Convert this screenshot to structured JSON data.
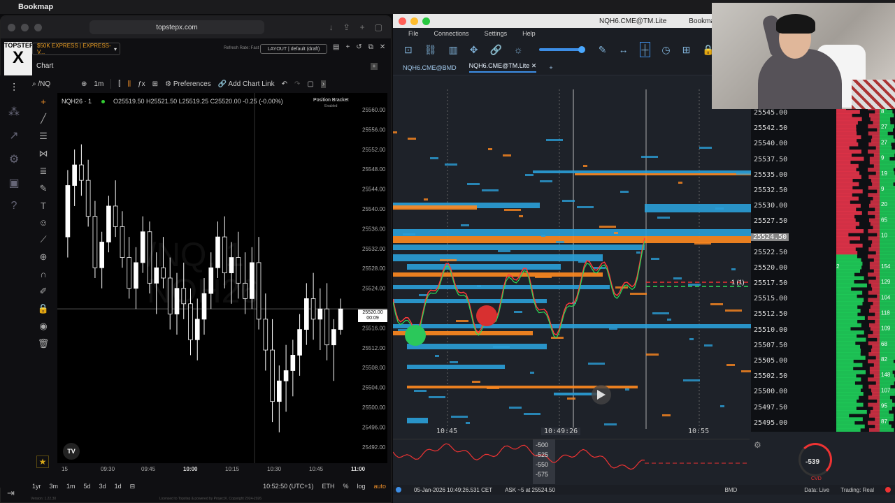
{
  "menubar": {
    "app": "Bookmap"
  },
  "browser": {
    "url": "topstepx.com",
    "logo_top": "TOPSTEP",
    "logo_big": "X",
    "account": "$50K EXPRESS | EXPRESS-V...",
    "refresh_rate": "Refresh Rate: Fast",
    "layout": "LAYOUT | default (draft)",
    "chart_tab": "Chart",
    "version": "Version: 1.22.30",
    "footer": "Licensed to Topstep & powered by ProjectX. Copyright 2024-2026"
  },
  "tv": {
    "symbol_search": "/NQ",
    "interval": "1m",
    "preferences": "Preferences",
    "add_chart_link": "Add Chart Link",
    "legend_symbol": "NQH26 · 1",
    "ohlc": "O25519.50  H25521.50  L25519.25  C25520.00  -0.25 (-0.00%)",
    "position_bracket": "Position Bracket",
    "position_bracket_sub": "Enabled",
    "watermark_line1": "/NQ, 1",
    "watermark_line2": "NQH26",
    "price_badge": "25520.00",
    "price_badge_timer": "00:09",
    "tv_logo": "TV",
    "price_ticks": [
      "25560.00",
      "25556.00",
      "25552.00",
      "25548.00",
      "25544.00",
      "25540.00",
      "25536.00",
      "25532.00",
      "25528.00",
      "25524.00",
      "",
      "25516.00",
      "25512.00",
      "25508.00",
      "25504.00",
      "25500.00",
      "25496.00",
      "25492.00"
    ],
    "time_ticks": [
      "15",
      "09:30",
      "09:45",
      "10:00",
      "10:15",
      "10:30",
      "10:45",
      "11:00"
    ],
    "ranges": [
      "1yr",
      "3m",
      "1m",
      "5d",
      "3d",
      "1d"
    ],
    "clock": "10:52:50 (UTC+1)",
    "session": "ETH",
    "pct": "%",
    "log": "log",
    "auto": "auto",
    "candles": [
      [
        25534,
        25547,
        25530,
        25544
      ],
      [
        25544,
        25551,
        25540,
        25548
      ],
      [
        25548,
        25552,
        25542,
        25545
      ],
      [
        25545,
        25549,
        25536,
        25538
      ],
      [
        25538,
        25541,
        25526,
        25528
      ],
      [
        25528,
        25535,
        25524,
        25533
      ],
      [
        25533,
        25542,
        25531,
        25540
      ],
      [
        25540,
        25545,
        25534,
        25536
      ],
      [
        25536,
        25539,
        25528,
        25530
      ],
      [
        25530,
        25534,
        25522,
        25524
      ],
      [
        25524,
        25532,
        25520,
        25529
      ],
      [
        25529,
        25538,
        25527,
        25535
      ],
      [
        25535,
        25537,
        25523,
        25525
      ],
      [
        25525,
        25531,
        25519,
        25528
      ],
      [
        25528,
        25534,
        25524,
        25526
      ],
      [
        25526,
        25530,
        25516,
        25519
      ],
      [
        25519,
        25527,
        25515,
        25524
      ],
      [
        25524,
        25529,
        25518,
        25521
      ],
      [
        25521,
        25524,
        25511,
        25514
      ],
      [
        25514,
        25522,
        25510,
        25518
      ],
      [
        25518,
        25526,
        25515,
        25523
      ],
      [
        25523,
        25531,
        25520,
        25528
      ],
      [
        25528,
        25537,
        25526,
        25534
      ],
      [
        25534,
        25538,
        25524,
        25527
      ],
      [
        25527,
        25533,
        25521,
        25530
      ],
      [
        25530,
        25535,
        25522,
        25525
      ],
      [
        25525,
        25531,
        25519,
        25522
      ],
      [
        25522,
        25532,
        25520,
        25529
      ],
      [
        25529,
        25534,
        25516,
        25518
      ],
      [
        25518,
        25523,
        25508,
        25512
      ],
      [
        25512,
        25518,
        25498,
        25502
      ],
      [
        25502,
        25509,
        25496,
        25506
      ],
      [
        25506,
        25513,
        25500,
        25508
      ],
      [
        25508,
        25514,
        25503,
        25511
      ],
      [
        25511,
        25519,
        25507,
        25516
      ],
      [
        25516,
        25525,
        25513,
        25522
      ],
      [
        25522,
        25527,
        25514,
        25518
      ],
      [
        25518,
        25524,
        25512,
        25520
      ],
      [
        25520,
        25525,
        25510,
        25513
      ],
      [
        25513,
        25518,
        25506,
        25516
      ],
      [
        25516,
        25522,
        25515,
        25520
      ]
    ]
  },
  "bookmap": {
    "title": "NQH6.CME@TM.Lite",
    "title_app": "Bookmap",
    "menu": [
      "File",
      "Connections",
      "Settings",
      "Help"
    ],
    "tabs": [
      "NQH6.CME@BMD",
      "NQH6.CME@TM.Lite"
    ],
    "prices": [
      "25545.00",
      "25542.50",
      "25540.00",
      "25537.50",
      "25535.00",
      "25532.50",
      "25530.00",
      "25527.50",
      "25524.50",
      "25522.50",
      "25520.00",
      "25517.50",
      "25515.00",
      "25512.50",
      "25510.00",
      "25507.50",
      "25505.00",
      "25502.50",
      "25500.00",
      "25497.50",
      "25495.00"
    ],
    "current_price": "25524.50",
    "current_price_index": 8,
    "times": [
      "10:45",
      "10:49:26",
      "10:55"
    ],
    "cvd_labels": [
      "-500",
      "-525",
      "-550",
      "-575"
    ],
    "cvd_value": "-539",
    "cvd_label": "CVD",
    "order_marker": "1 (1)",
    "status_time": "05-Jan-2026 10:49:26.531 CET",
    "status_ask": "ASK ~5 at 25524.50",
    "status_source": "BMD",
    "status_data": "Data: Live",
    "status_trading": "Trading: Real",
    "dom_bid_sizes": [
      "8",
      "27",
      "27",
      "9",
      "19",
      "9",
      "20",
      "65",
      "10",
      "",
      "154",
      "129",
      "104",
      "118",
      "109",
      "68",
      "82",
      "148",
      "107",
      "95",
      "87"
    ],
    "dom_sizes_left": [
      "",
      "",
      "",
      "",
      "",
      "",
      "",
      "",
      "",
      "",
      "2",
      "",
      "",
      "",
      "",
      "",
      "",
      "",
      "",
      "",
      ""
    ]
  },
  "colors": {
    "accent": "#3d8ee6",
    "bid": "#1fd25a",
    "ask": "#e8344a",
    "heat_orange": "#ff8a1f",
    "heat_blue": "#2aa0d8"
  }
}
